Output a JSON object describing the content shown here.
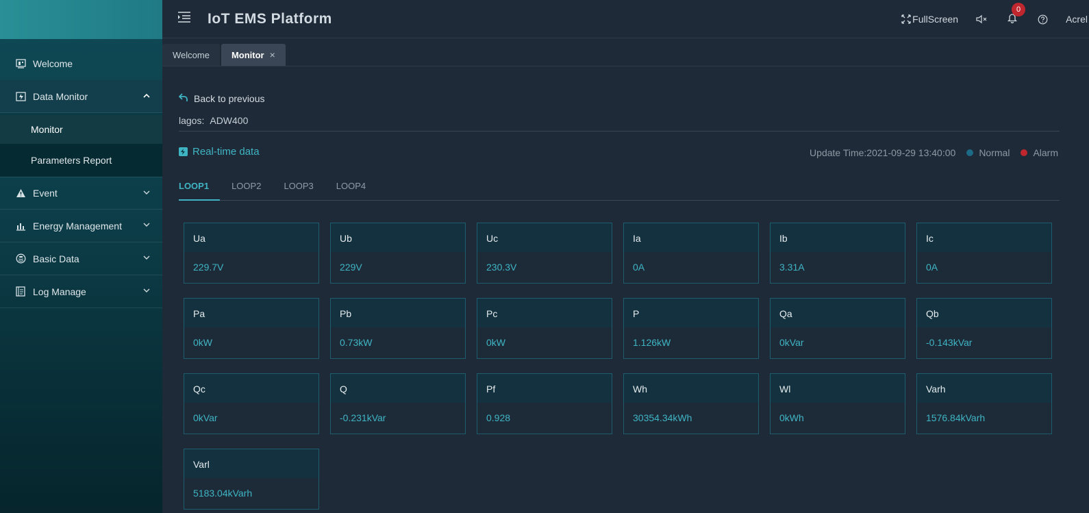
{
  "sidebar": {
    "items": [
      {
        "label": "Welcome",
        "icon": "welcome-icon"
      },
      {
        "label": "Data Monitor",
        "icon": "monitor-icon",
        "expanded": true,
        "children": [
          {
            "label": "Monitor",
            "active": true
          },
          {
            "label": "Parameters Report"
          }
        ]
      },
      {
        "label": "Event",
        "icon": "warning-icon"
      },
      {
        "label": "Energy Management",
        "icon": "bar-chart-icon"
      },
      {
        "label": "Basic Data",
        "icon": "database-icon"
      },
      {
        "label": "Log Manage",
        "icon": "log-icon"
      }
    ]
  },
  "header": {
    "title": "IoT EMS Platform",
    "fullscreen_label": "FullScreen",
    "notification_count": "0",
    "user": "Acrel"
  },
  "tabs": [
    {
      "label": "Welcome",
      "active": false
    },
    {
      "label": "Monitor",
      "active": true,
      "close": "×"
    }
  ],
  "main": {
    "back_label": "Back to previous",
    "device_label": "lagos:",
    "device_value": "ADW400",
    "realtime_label": "Real-time data",
    "update_time": "Update Time:2021-09-29 13:40:00",
    "legend_normal": "Normal",
    "legend_alarm": "Alarm",
    "loops": [
      "LOOP1",
      "LOOP2",
      "LOOP3",
      "LOOP4"
    ],
    "active_loop": "LOOP1",
    "cards": [
      {
        "name": "Ua",
        "value": "229.7V"
      },
      {
        "name": "Ub",
        "value": "229V"
      },
      {
        "name": "Uc",
        "value": "230.3V"
      },
      {
        "name": "Ia",
        "value": "0A"
      },
      {
        "name": "Ib",
        "value": "3.31A"
      },
      {
        "name": "Ic",
        "value": "0A"
      },
      {
        "name": "Pa",
        "value": "0kW"
      },
      {
        "name": "Pb",
        "value": "0.73kW"
      },
      {
        "name": "Pc",
        "value": "0kW"
      },
      {
        "name": "P",
        "value": "1.126kW"
      },
      {
        "name": "Qa",
        "value": "0kVar"
      },
      {
        "name": "Qb",
        "value": "-0.143kVar"
      },
      {
        "name": "Qc",
        "value": "0kVar"
      },
      {
        "name": "Q",
        "value": "-0.231kVar"
      },
      {
        "name": "Pf",
        "value": "0.928"
      },
      {
        "name": "Wh",
        "value": "30354.34kWh"
      },
      {
        "name": "Wl",
        "value": "0kWh"
      },
      {
        "name": "Varh",
        "value": "1576.84kVarh"
      },
      {
        "name": "Varl",
        "value": "5183.04kVarh"
      }
    ]
  },
  "colors": {
    "accent": "#3fb5c4",
    "normal": "#1c6a86",
    "alarm": "#c0262d"
  }
}
